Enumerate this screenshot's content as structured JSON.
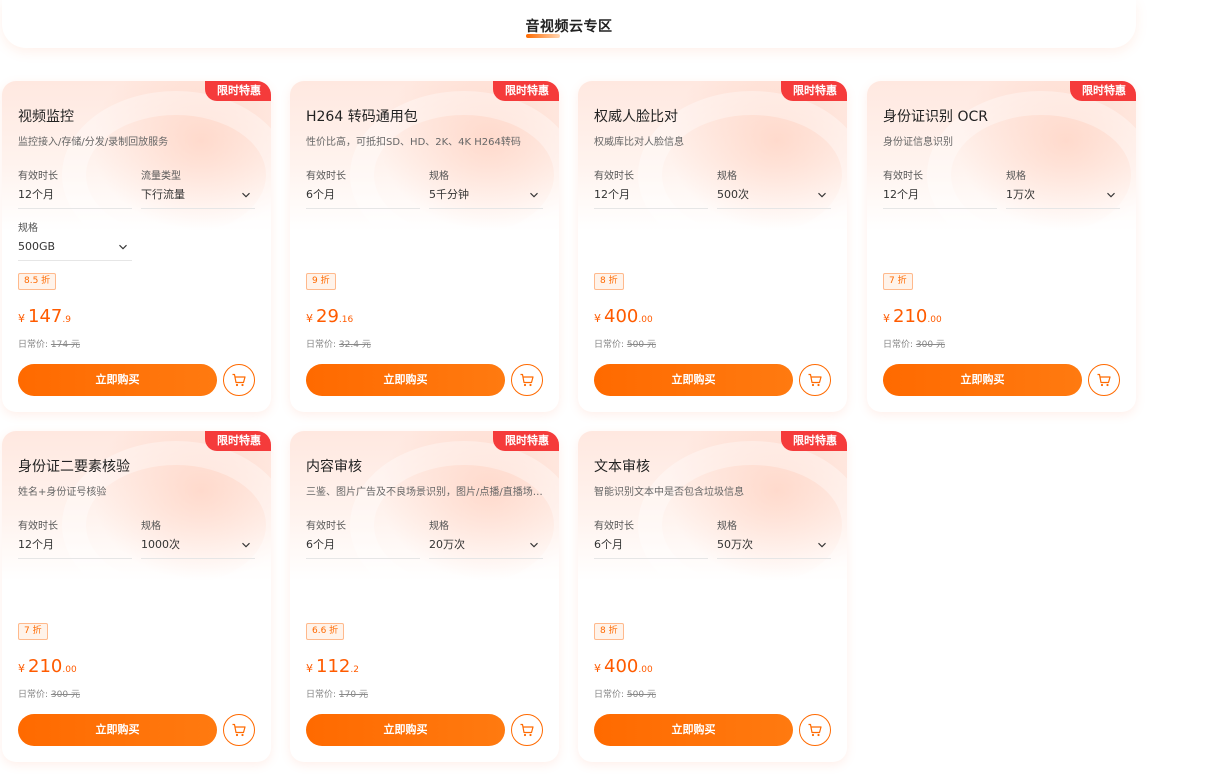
{
  "header": {
    "title": "音视频云专区"
  },
  "products": [
    {
      "badge": "限时特惠",
      "title": "视频监控",
      "desc": "监控接入/存储/分发/录制回放服务",
      "fields": [
        {
          "label": "有效时长",
          "value": "12个月",
          "dropdown": false
        },
        {
          "label": "流量类型",
          "value": "下行流量",
          "dropdown": true
        },
        {
          "label": "规格",
          "value": "500GB",
          "dropdown": true
        }
      ],
      "discount": "8.5 折",
      "price_int": "147",
      "price_dec": ".9",
      "orig_label": "日常价:",
      "orig_value": "174 元",
      "buy_label": "立即购买"
    },
    {
      "badge": "限时特惠",
      "title": "H264 转码通用包",
      "desc": "性价比高，可抵扣SD、HD、2K、4K H264转码",
      "fields": [
        {
          "label": "有效时长",
          "value": "6个月",
          "dropdown": false
        },
        {
          "label": "规格",
          "value": "5千分钟",
          "dropdown": true
        }
      ],
      "discount": "9 折",
      "price_int": "29",
      "price_dec": ".16",
      "orig_label": "日常价:",
      "orig_value": "32.4 元",
      "buy_label": "立即购买"
    },
    {
      "badge": "限时特惠",
      "title": "权威人脸比对",
      "desc": "权威库比对人脸信息",
      "fields": [
        {
          "label": "有效时长",
          "value": "12个月",
          "dropdown": false
        },
        {
          "label": "规格",
          "value": "500次",
          "dropdown": true
        }
      ],
      "discount": "8 折",
      "price_int": "400",
      "price_dec": ".00",
      "orig_label": "日常价:",
      "orig_value": "500 元",
      "buy_label": "立即购买"
    },
    {
      "badge": "限时特惠",
      "title": "身份证识别 OCR",
      "desc": "身份证信息识别",
      "fields": [
        {
          "label": "有效时长",
          "value": "12个月",
          "dropdown": false
        },
        {
          "label": "规格",
          "value": "1万次",
          "dropdown": true
        }
      ],
      "discount": "7 折",
      "price_int": "210",
      "price_dec": ".00",
      "orig_label": "日常价:",
      "orig_value": "300 元",
      "buy_label": "立即购买"
    },
    {
      "badge": "限时特惠",
      "title": "身份证二要素核验",
      "desc": "姓名+身份证号核验",
      "fields": [
        {
          "label": "有效时长",
          "value": "12个月",
          "dropdown": false
        },
        {
          "label": "规格",
          "value": "1000次",
          "dropdown": true
        }
      ],
      "discount": "7 折",
      "price_int": "210",
      "price_dec": ".00",
      "orig_label": "日常价:",
      "orig_value": "300 元",
      "buy_label": "立即购买"
    },
    {
      "badge": "限时特惠",
      "title": "内容审核",
      "desc": "三鉴、图片广告及不良场景识别，图片/点播/直播场景...",
      "fields": [
        {
          "label": "有效时长",
          "value": "6个月",
          "dropdown": false
        },
        {
          "label": "规格",
          "value": "20万次",
          "dropdown": true
        }
      ],
      "discount": "6.6 折",
      "price_int": "112",
      "price_dec": ".2",
      "orig_label": "日常价:",
      "orig_value": "170 元",
      "buy_label": "立即购买"
    },
    {
      "badge": "限时特惠",
      "title": "文本审核",
      "desc": "智能识别文本中是否包含垃圾信息",
      "fields": [
        {
          "label": "有效时长",
          "value": "6个月",
          "dropdown": false
        },
        {
          "label": "规格",
          "value": "50万次",
          "dropdown": true
        }
      ],
      "discount": "8 折",
      "price_int": "400",
      "price_dec": ".00",
      "orig_label": "日常价:",
      "orig_value": "500 元",
      "buy_label": "立即购买"
    }
  ],
  "currency_symbol": "¥",
  "colors": {
    "accent": "#ff6a00",
    "badge": "#f53b3b",
    "price": "#ff5b00"
  },
  "icons": {
    "cart": "shopping-cart-icon",
    "chevron": "chevron-down-icon"
  }
}
